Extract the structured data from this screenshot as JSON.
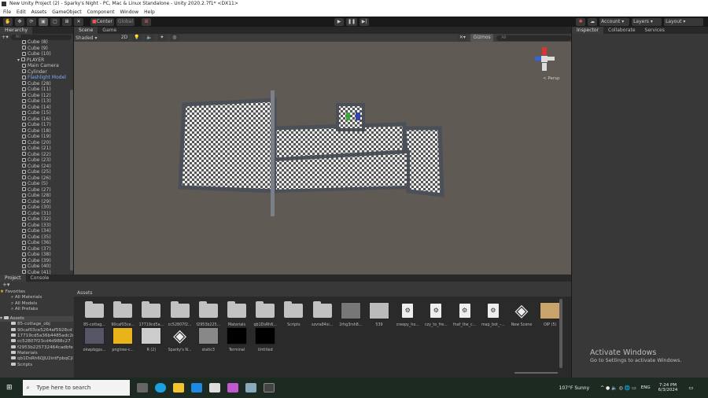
{
  "window": {
    "title": "New Unity Project (2) - Sparky's Night - PC, Mac & Linux Standalone - Unity 2020.2.7f1* <DX11>"
  },
  "menu": [
    "File",
    "Edit",
    "Assets",
    "GameObject",
    "Component",
    "Window",
    "Help"
  ],
  "toolbar": {
    "tools": [
      "hand-icon",
      "move-icon",
      "rotate-icon",
      "scale-icon",
      "rect-icon",
      "transform-icon",
      "custom-icon"
    ],
    "pivot": "Center",
    "space": "Global",
    "account": "Account",
    "layers": "Layers",
    "layout": "Layout"
  },
  "hierarchy": {
    "tab": "Hierarchy",
    "search_placeholder": "All",
    "items": [
      {
        "label": "Cube (8)",
        "indent": 1
      },
      {
        "label": "Cube (9)",
        "indent": 1
      },
      {
        "label": "Cube (10)",
        "indent": 1
      },
      {
        "label": "PLAYER",
        "indent": 1,
        "expanded": true
      },
      {
        "label": "Main Camera",
        "indent": 2
      },
      {
        "label": "Cylinder",
        "indent": 2
      },
      {
        "label": "Flashlight Model",
        "indent": 2,
        "selected": true
      },
      {
        "label": "Cube (28)",
        "indent": 2
      },
      {
        "label": "Cube (11)",
        "indent": 1
      },
      {
        "label": "Cube (12)",
        "indent": 1
      },
      {
        "label": "Cube (13)",
        "indent": 1
      },
      {
        "label": "Cube (14)",
        "indent": 1
      },
      {
        "label": "Cube (15)",
        "indent": 1
      },
      {
        "label": "Cube (16)",
        "indent": 1
      },
      {
        "label": "Cube (17)",
        "indent": 1
      },
      {
        "label": "Cube (18)",
        "indent": 1
      },
      {
        "label": "Cube (19)",
        "indent": 1
      },
      {
        "label": "Cube (20)",
        "indent": 1
      },
      {
        "label": "Cube (21)",
        "indent": 1
      },
      {
        "label": "Cube (22)",
        "indent": 1
      },
      {
        "label": "Cube (23)",
        "indent": 1
      },
      {
        "label": "Cube (24)",
        "indent": 1
      },
      {
        "label": "Cube (25)",
        "indent": 1
      },
      {
        "label": "Cube (26)",
        "indent": 1
      },
      {
        "label": "Cube (5)",
        "indent": 1
      },
      {
        "label": "Cube (27)",
        "indent": 1
      },
      {
        "label": "Cube (28)",
        "indent": 1
      },
      {
        "label": "Cube (29)",
        "indent": 1
      },
      {
        "label": "Cube (30)",
        "indent": 1
      },
      {
        "label": "Cube (31)",
        "indent": 1
      },
      {
        "label": "Cube (32)",
        "indent": 1
      },
      {
        "label": "Cube (33)",
        "indent": 1
      },
      {
        "label": "Cube (34)",
        "indent": 1
      },
      {
        "label": "Cube (35)",
        "indent": 1
      },
      {
        "label": "Cube (36)",
        "indent": 1
      },
      {
        "label": "Cube (37)",
        "indent": 1
      },
      {
        "label": "Cube (38)",
        "indent": 1
      },
      {
        "label": "Cube (39)",
        "indent": 1
      },
      {
        "label": "Cube (40)",
        "indent": 1
      },
      {
        "label": "Cube (41)",
        "indent": 1
      }
    ]
  },
  "scene": {
    "tabs": [
      "Scene",
      "Game"
    ],
    "shading": "Shaded",
    "mode_2d": "2D",
    "gizmos": "Gizmos",
    "search_placeholder": "All",
    "projection": "< Persp",
    "axes": [
      "y",
      "z",
      "x"
    ]
  },
  "inspector": {
    "tabs": [
      "Inspector",
      "Collaborate",
      "Services"
    ]
  },
  "project": {
    "tabs": [
      "Project",
      "Console"
    ],
    "favorites": {
      "label": "Favorites",
      "items": [
        "All Materials",
        "All Models",
        "All Prefabs"
      ]
    },
    "assets_label": "Assets",
    "folders": [
      "85-cottage_obj",
      "90caf03ce5264af5928cd",
      "17719cd5a36b4485adc2r",
      "cc52807f23cd4d988c27",
      "f2953b225732464cadbfe",
      "Materials",
      "qb1DsRh6QJU2intFpbqCjl",
      "Scripts"
    ],
    "breadcrumb": "Assets",
    "assets": [
      {
        "name": "85-cottag...",
        "type": "folder"
      },
      {
        "name": "90caf03ce...",
        "type": "folder"
      },
      {
        "name": "17719cd5a...",
        "type": "folder"
      },
      {
        "name": "cc52807f2...",
        "type": "folder"
      },
      {
        "name": "f2953b225...",
        "type": "folder"
      },
      {
        "name": "Materials",
        "type": "folder"
      },
      {
        "name": "qb1DsRh6...",
        "type": "folder"
      },
      {
        "name": "Scripts",
        "type": "folder"
      },
      {
        "name": "szvra84si...",
        "type": "folder"
      },
      {
        "name": "2rhg3rsh8...",
        "type": "texture"
      },
      {
        "name": "539",
        "type": "texture"
      },
      {
        "name": "creepy_ho...",
        "type": "file"
      },
      {
        "name": "czy_to_fre...",
        "type": "file"
      },
      {
        "name": "fnaf_the_c...",
        "type": "file"
      },
      {
        "name": "map_bot_-...",
        "type": "file"
      },
      {
        "name": "New Scene",
        "type": "scene"
      },
      {
        "name": "OIP (5)",
        "type": "texture"
      },
      {
        "name": "okwpbgps...",
        "type": "texture"
      },
      {
        "name": "pngtree-c...",
        "type": "texture"
      },
      {
        "name": "R (2)",
        "type": "texture"
      },
      {
        "name": "Sparky's N...",
        "type": "scene"
      },
      {
        "name": "static3",
        "type": "texture"
      },
      {
        "name": "Terminal",
        "type": "texture"
      },
      {
        "name": "Untitled",
        "type": "texture"
      }
    ]
  },
  "watermark": {
    "title": "Activate Windows",
    "subtitle": "Go to Settings to activate Windows."
  },
  "taskbar": {
    "search_placeholder": "Type here to search",
    "weather": "107°F  Sunny",
    "language": "ENG",
    "time": "7:24 PM",
    "date": "6/3/2024"
  }
}
